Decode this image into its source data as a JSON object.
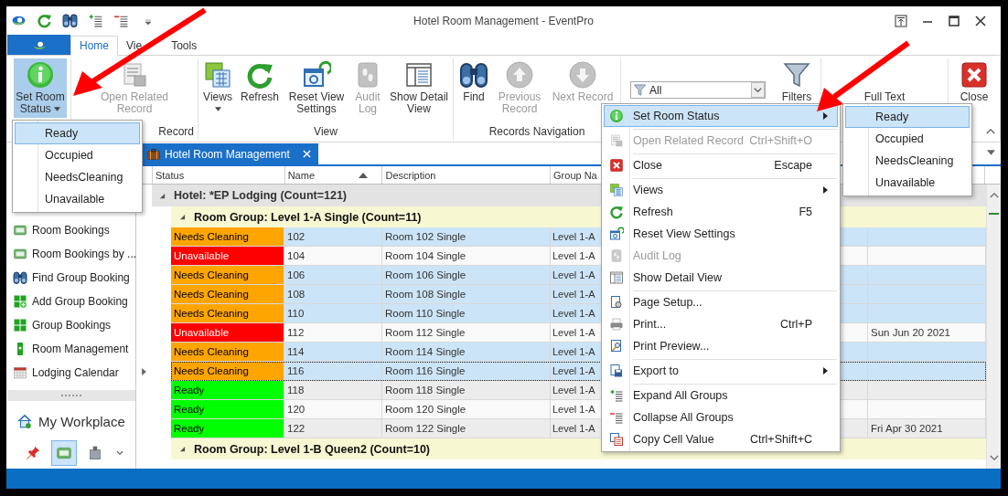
{
  "window": {
    "title": "Hotel Room Management - EventPro"
  },
  "ribbon_tabs": [
    {
      "label": "Home",
      "selected": true
    },
    {
      "label": "Vie",
      "selected": false
    },
    {
      "label": "Tools",
      "selected": false
    }
  ],
  "ribbon_groups": [
    {
      "buttons": [
        {
          "label": "Set Room Status",
          "pressed": true,
          "disabled": false,
          "dropdown": true
        }
      ]
    },
    {
      "label": "Record",
      "buttons": [
        {
          "label": "Open Related Record",
          "pressed": false,
          "disabled": true,
          "dropdown": false
        }
      ]
    },
    {
      "label": "View",
      "buttons": [
        {
          "label": "Views",
          "pressed": false,
          "disabled": false,
          "dropdown": true
        },
        {
          "label": "Refresh",
          "pressed": false,
          "disabled": false,
          "dropdown": false
        },
        {
          "label": "Reset View Settings",
          "pressed": false,
          "disabled": false,
          "dropdown": false
        },
        {
          "label": "Audit Log",
          "pressed": false,
          "disabled": true,
          "dropdown": false
        },
        {
          "label": "Show Detail View",
          "pressed": false,
          "disabled": false,
          "dropdown": false
        }
      ]
    },
    {
      "label": "Records Navigation",
      "buttons": [
        {
          "label": "Find",
          "pressed": false,
          "disabled": false,
          "dropdown": false
        },
        {
          "label": "Previous Record",
          "pressed": false,
          "disabled": true,
          "dropdown": false
        },
        {
          "label": "Next Record",
          "pressed": false,
          "disabled": true,
          "dropdown": false
        }
      ]
    },
    {
      "filter": {
        "value": "All"
      },
      "buttons": [
        {
          "label": "Filters",
          "pressed": false,
          "disabled": false,
          "dropdown": false
        }
      ]
    },
    {
      "buttons": [
        {
          "label": "Full Text",
          "pressed": false,
          "disabled": false,
          "dropdown": false
        }
      ]
    },
    {
      "buttons": [
        {
          "label": "Close",
          "pressed": false,
          "disabled": false,
          "dropdown": false
        }
      ]
    }
  ],
  "ribbon_dropdown": {
    "items": [
      {
        "label": "Ready",
        "selected": true
      },
      {
        "label": "Occupied",
        "selected": false
      },
      {
        "label": "NeedsCleaning",
        "selected": false
      },
      {
        "label": "Unavailable",
        "selected": false
      }
    ]
  },
  "sidebar": {
    "items": [
      {
        "label": "Room Bookings"
      },
      {
        "label": "Room Bookings by ..."
      },
      {
        "label": "Find Group Booking"
      },
      {
        "label": "Add Group Booking"
      },
      {
        "label": "Group Bookings"
      },
      {
        "label": "Room Management"
      },
      {
        "label": "Lodging Calendar"
      }
    ],
    "workplace": {
      "label": "My Workplace"
    },
    "bottom_buttons": [
      {
        "selected": false
      },
      {
        "selected": true
      },
      {
        "selected": false
      }
    ]
  },
  "document_tabs": [
    {
      "label": "Hotel Room Management",
      "selected": true
    }
  ],
  "grid": {
    "columns": [
      {
        "label": "Status",
        "sorted": false
      },
      {
        "label": "Name",
        "sorted": true
      },
      {
        "label": "Description",
        "sorted": false
      },
      {
        "label": "Group Na"
      }
    ],
    "groups": [
      {
        "label": "Hotel: *EP Lodging (Count=121)",
        "expanded": true,
        "children": [
          {
            "label": "Room Group: Level 1-A Single (Count=11)",
            "expanded": true,
            "rows": [
              {
                "status": "Needs Cleaning",
                "color": "#ffa500",
                "name": "102",
                "description": "Room 102 Single",
                "group_name": "Level 1-A",
                "selected": true,
                "focused": false
              },
              {
                "status": "Unavailable",
                "color": "#ff0000",
                "name": "104",
                "description": "Room 104 Single",
                "group_name": "Level 1-A",
                "selected": false,
                "focused": false
              },
              {
                "status": "Needs Cleaning",
                "color": "#ffa500",
                "name": "106",
                "description": "Room 106 Single",
                "group_name": "Level 1-A",
                "selected": true,
                "focused": false
              },
              {
                "status": "Needs Cleaning",
                "color": "#ffa500",
                "name": "108",
                "description": "Room 108 Single",
                "group_name": "Level 1-A",
                "selected": true,
                "focused": false
              },
              {
                "status": "Needs Cleaning",
                "color": "#ffa500",
                "name": "110",
                "description": "Room 110 Single",
                "group_name": "Level 1-A",
                "selected": true,
                "focused": false
              },
              {
                "status": "Unavailable",
                "color": "#ff0000",
                "name": "112",
                "description": "Room 112 Single",
                "group_name": "Level 1-A",
                "date": "Sun Jun 20 2021",
                "selected": false,
                "focused": false
              },
              {
                "status": "Needs Cleaning",
                "color": "#ffa500",
                "name": "114",
                "description": "Room 114 Single",
                "group_name": "Level 1-A",
                "selected": true,
                "focused": false
              },
              {
                "status": "Needs Cleaning",
                "color": "#ffa500",
                "name": "116",
                "description": "Room 116 Single",
                "group_name": "Level 1-A",
                "selected": true,
                "focused": true
              },
              {
                "status": "Ready",
                "color": "#00ff00",
                "name": "118",
                "description": "Room 118 Single",
                "group_name": "Level 1-A",
                "selected": false,
                "focused": false
              },
              {
                "status": "Ready",
                "color": "#00ff00",
                "name": "120",
                "description": "Room 120 Single",
                "group_name": "Level 1-A",
                "selected": false,
                "focused": false
              },
              {
                "status": "Ready",
                "color": "#00ff00",
                "name": "122",
                "description": "Room 122 Single",
                "group_name": "Level 1-A",
                "date": "Fri Apr 30 2021",
                "selected": false,
                "focused": false
              }
            ]
          },
          {
            "label": "Room Group: Level 1-B Queen2 (Count=10)",
            "expanded": true
          }
        ]
      }
    ]
  },
  "context_menu": {
    "items": [
      {
        "label": "Set Room Status",
        "disabled": false,
        "submenu": true,
        "selected": true,
        "separator_before": false
      },
      {
        "label": "Open Related Record",
        "shortcut": "Ctrl+Shift+O",
        "disabled": true,
        "submenu": false,
        "selected": false,
        "separator_before": true
      },
      {
        "label": "Close",
        "shortcut": "Escape",
        "disabled": false,
        "submenu": false,
        "selected": false,
        "separator_before": true
      },
      {
        "label": "Views",
        "disabled": false,
        "submenu": true,
        "selected": false,
        "separator_before": true
      },
      {
        "label": "Refresh",
        "shortcut": "F5",
        "disabled": false,
        "submenu": false,
        "selected": false,
        "separator_before": false
      },
      {
        "label": "Reset View Settings",
        "disabled": false,
        "submenu": false,
        "selected": false,
        "separator_before": false
      },
      {
        "label": "Audit Log",
        "disabled": true,
        "submenu": false,
        "selected": false,
        "separator_before": false
      },
      {
        "label": "Show Detail View",
        "disabled": false,
        "submenu": false,
        "selected": false,
        "separator_before": false
      },
      {
        "label": "Page Setup...",
        "disabled": false,
        "submenu": false,
        "selected": false,
        "separator_before": true
      },
      {
        "label": "Print...",
        "shortcut": "Ctrl+P",
        "disabled": false,
        "submenu": false,
        "selected": false,
        "separator_before": false
      },
      {
        "label": "Print Preview...",
        "disabled": false,
        "submenu": false,
        "selected": false,
        "separator_before": false
      },
      {
        "label": "Export to",
        "disabled": false,
        "submenu": true,
        "selected": false,
        "separator_before": true
      },
      {
        "label": "Expand All Groups",
        "disabled": false,
        "submenu": false,
        "selected": false,
        "separator_before": true
      },
      {
        "label": "Collapse All Groups",
        "disabled": false,
        "submenu": false,
        "selected": false,
        "separator_before": false
      },
      {
        "label": "Copy Cell Value",
        "shortcut": "Ctrl+Shift+C",
        "disabled": false,
        "submenu": false,
        "selected": false,
        "separator_before": false
      }
    ]
  },
  "context_submenu": {
    "items": [
      {
        "label": "Ready",
        "selected": true
      },
      {
        "label": "Occupied",
        "selected": false
      },
      {
        "label": "NeedsCleaning",
        "selected": false
      },
      {
        "label": "Unavailable",
        "selected": false
      }
    ]
  }
}
